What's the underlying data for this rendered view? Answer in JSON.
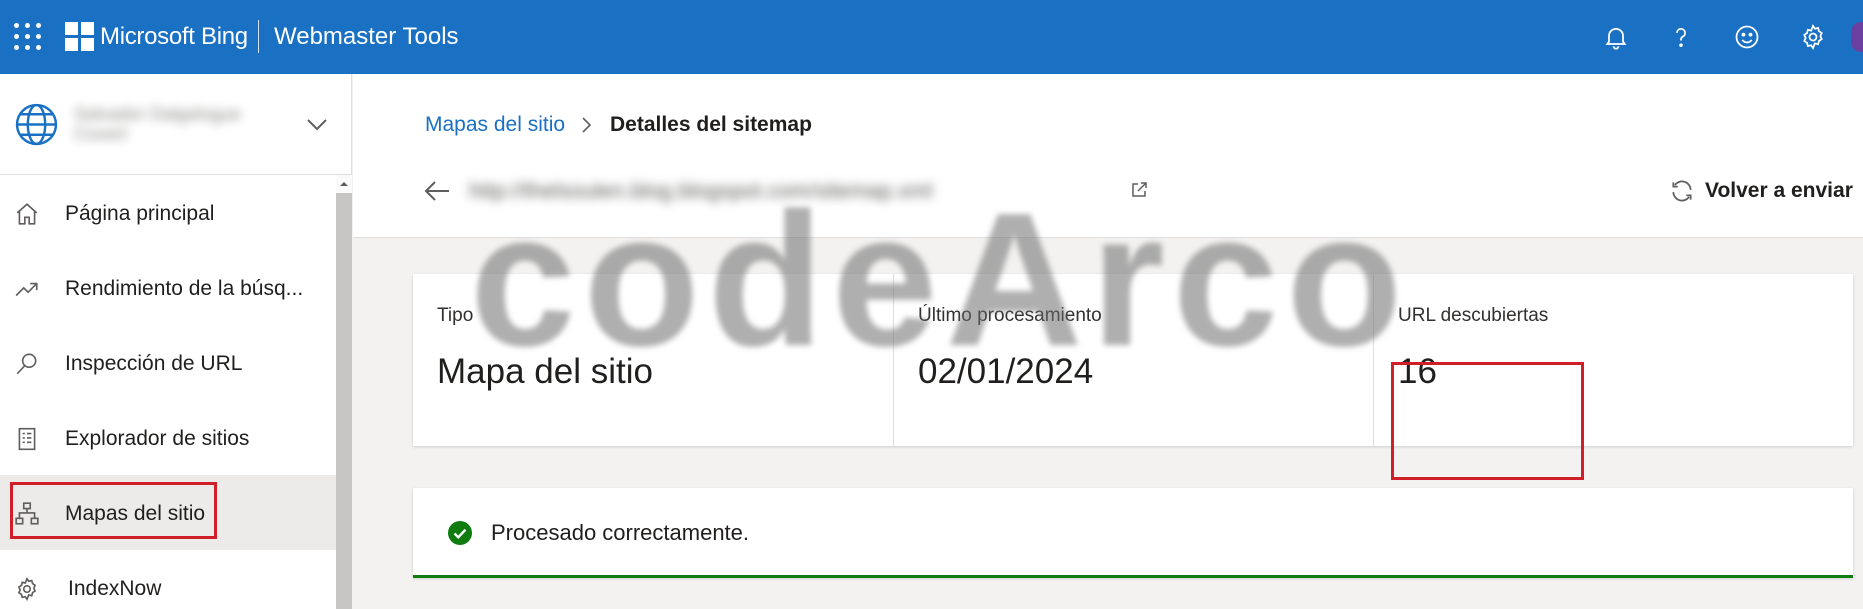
{
  "topbar": {
    "brand": "Microsoft Bing",
    "product": "Webmaster Tools",
    "icons": [
      "bell-icon",
      "help-icon",
      "feedback-smiley-icon",
      "settings-gear-icon"
    ],
    "color": "#1a71c4"
  },
  "sidebar": {
    "site_name": "Salvador Dalgelogue Covert",
    "items": [
      {
        "label": "Página principal",
        "icon": "home-icon"
      },
      {
        "label": "Rendimiento de la búsq...",
        "icon": "trend-icon"
      },
      {
        "label": "Inspección de URL",
        "icon": "search-icon"
      },
      {
        "label": "Explorador de sitios",
        "icon": "document-list-icon"
      },
      {
        "label": "Mapas del sitio",
        "icon": "sitemap-icon",
        "active": true
      },
      {
        "label": "IndexNow",
        "icon": "gear-icon"
      }
    ]
  },
  "breadcrumb": {
    "parent": "Mapas del sitio",
    "current": "Detalles del sitemap"
  },
  "header": {
    "sitemap_url": "http://thelsoulen.blog.blogspot.com/sitemap.xml",
    "resubmit_label": "Volver a enviar"
  },
  "stats": [
    {
      "label": "Tipo",
      "value": "Mapa del sitio"
    },
    {
      "label": "Último procesamiento",
      "value": "02/01/2024"
    },
    {
      "label": "URL descubiertas",
      "value": "16"
    }
  ],
  "status": {
    "text": "Procesado correctamente.",
    "color": "#107c10"
  },
  "watermark": "codeArco",
  "annotation_color": "#d11f2a"
}
